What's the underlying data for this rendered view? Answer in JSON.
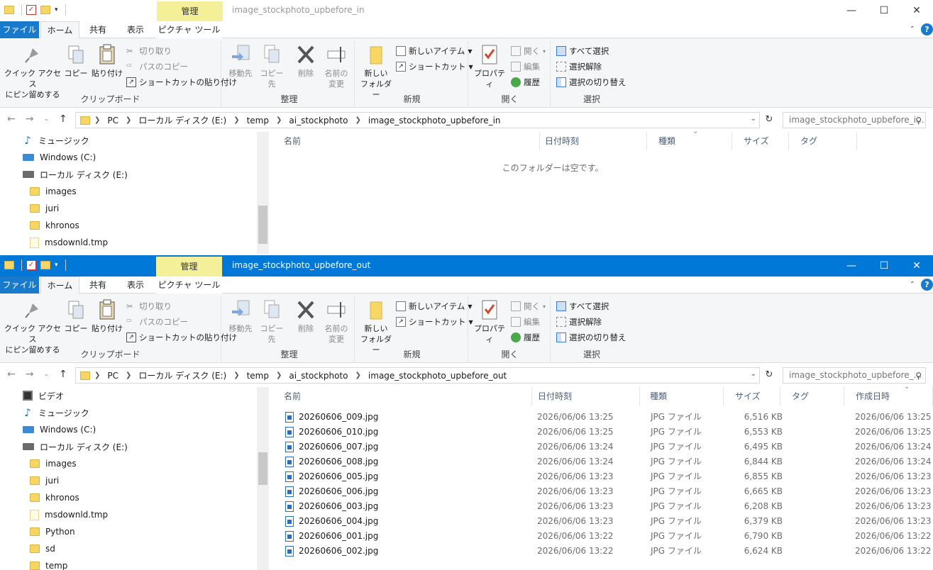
{
  "colors": {
    "accent": "#0078d7",
    "manage_tab": "#f4f09a",
    "file_tab": "#1979ca"
  },
  "ribbon": {
    "tabs": {
      "file": "ファイル",
      "home": "ホーム",
      "share": "共有",
      "view": "表示",
      "picture_tools": "ピクチャ ツール"
    },
    "manage": "管理",
    "clipboard": {
      "pin": "クイック アクセス\nにピン留めする",
      "copy": "コピー",
      "paste": "貼り付け",
      "cut": "切り取り",
      "copy_path": "パスのコピー",
      "paste_shortcut": "ショートカットの貼り付け",
      "label": "クリップボード"
    },
    "organize": {
      "move_to": "移動先",
      "copy_to": "コピー先",
      "delete": "削除",
      "rename": "名前の\n変更",
      "label": "整理"
    },
    "new": {
      "new_folder": "新しい\nフォルダー",
      "new_item": "新しいアイテム",
      "shortcut": "ショートカット",
      "label": "新規"
    },
    "open": {
      "properties": "プロパティ",
      "open": "開く",
      "edit": "編集",
      "history": "履歴",
      "label": "開く"
    },
    "select": {
      "select_all": "すべて選択",
      "select_none": "選択解除",
      "invert": "選択の切り替え",
      "label": "選択"
    }
  },
  "window1": {
    "title": "image_stockphoto_upbefore_in",
    "breadcrumb": [
      "PC",
      "ローカル ディスク (E:)",
      "temp",
      "ai_stockphoto",
      "image_stockphoto_upbefore_in"
    ],
    "search_placeholder": "image_stockphoto_upbefore_i...",
    "nav": [
      "ミュージック",
      "Windows (C:)",
      "ローカル ディスク (E:)",
      "images",
      "juri",
      "khronos",
      "msdownld.tmp"
    ],
    "columns": {
      "name": "名前",
      "date": "日付時刻",
      "type": "種類",
      "size": "サイズ",
      "tag": "タグ"
    },
    "empty_message": "このフォルダーは空です。"
  },
  "window2": {
    "title": "image_stockphoto_upbefore_out",
    "breadcrumb": [
      "PC",
      "ローカル ディスク (E:)",
      "temp",
      "ai_stockphoto",
      "image_stockphoto_upbefore_out"
    ],
    "search_placeholder": "image_stockphoto_upbefore_...",
    "nav": [
      "ビデオ",
      "ミュージック",
      "Windows (C:)",
      "ローカル ディスク (E:)",
      "images",
      "juri",
      "khronos",
      "msdownld.tmp",
      "Python",
      "sd",
      "temp"
    ],
    "columns": {
      "name": "名前",
      "date": "日付時刻",
      "type": "種類",
      "size": "サイズ",
      "tag": "タグ",
      "created": "作成日時"
    },
    "files": [
      {
        "name": "20260606_009.jpg",
        "date": "2026/06/06 13:25",
        "type": "JPG ファイル",
        "size": "6,516 KB",
        "created": "2026/06/06 13:25"
      },
      {
        "name": "20260606_010.jpg",
        "date": "2026/06/06 13:25",
        "type": "JPG ファイル",
        "size": "6,553 KB",
        "created": "2026/06/06 13:25"
      },
      {
        "name": "20260606_007.jpg",
        "date": "2026/06/06 13:24",
        "type": "JPG ファイル",
        "size": "6,495 KB",
        "created": "2026/06/06 13:24"
      },
      {
        "name": "20260606_008.jpg",
        "date": "2026/06/06 13:24",
        "type": "JPG ファイル",
        "size": "6,844 KB",
        "created": "2026/06/06 13:24"
      },
      {
        "name": "20260606_005.jpg",
        "date": "2026/06/06 13:23",
        "type": "JPG ファイル",
        "size": "6,855 KB",
        "created": "2026/06/06 13:23"
      },
      {
        "name": "20260606_006.jpg",
        "date": "2026/06/06 13:23",
        "type": "JPG ファイル",
        "size": "6,665 KB",
        "created": "2026/06/06 13:23"
      },
      {
        "name": "20260606_003.jpg",
        "date": "2026/06/06 13:23",
        "type": "JPG ファイル",
        "size": "6,208 KB",
        "created": "2026/06/06 13:23"
      },
      {
        "name": "20260606_004.jpg",
        "date": "2026/06/06 13:23",
        "type": "JPG ファイル",
        "size": "6,379 KB",
        "created": "2026/06/06 13:23"
      },
      {
        "name": "20260606_001.jpg",
        "date": "2026/06/06 13:22",
        "type": "JPG ファイル",
        "size": "6,790 KB",
        "created": "2026/06/06 13:22"
      },
      {
        "name": "20260606_002.jpg",
        "date": "2026/06/06 13:22",
        "type": "JPG ファイル",
        "size": "6,624 KB",
        "created": "2026/06/06 13:22"
      }
    ]
  }
}
